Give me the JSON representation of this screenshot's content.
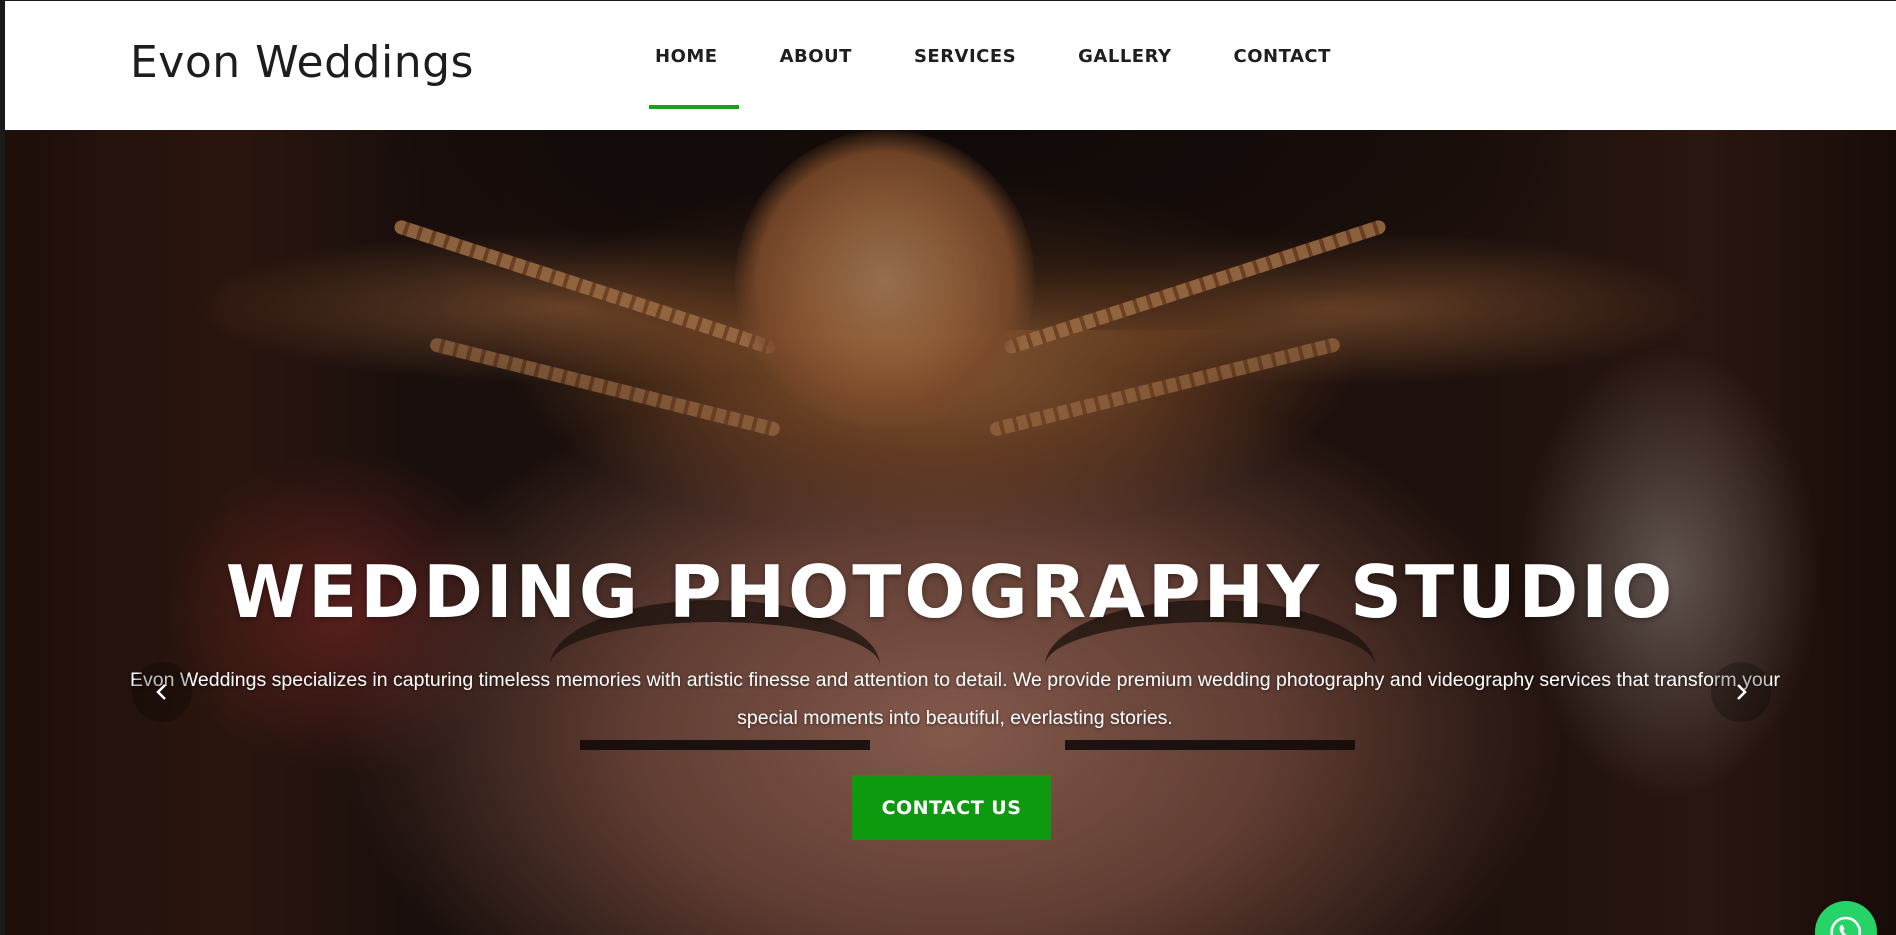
{
  "brand": {
    "name": "Evon Weddings"
  },
  "nav": {
    "items": [
      {
        "label": "HOME",
        "active": true
      },
      {
        "label": "ABOUT",
        "active": false
      },
      {
        "label": "SERVICES",
        "active": false
      },
      {
        "label": "GALLERY",
        "active": false
      },
      {
        "label": "CONTACT",
        "active": false
      }
    ],
    "active_color": "#14a314"
  },
  "hero": {
    "title": "WEDDING PHOTOGRAPHY STUDIO",
    "description": "Evon Weddings specializes in capturing timeless memories with artistic finesse and attention to detail. We provide premium wedding photography and videography services that transform your special moments into beautiful, everlasting stories.",
    "cta_label": "CONTACT US",
    "cta_color": "#0e9a0e",
    "prev_icon": "chevron-left-icon",
    "next_icon": "chevron-right-icon"
  },
  "floating": {
    "whatsapp_icon": "whatsapp-icon",
    "whatsapp_color": "#25d366"
  }
}
